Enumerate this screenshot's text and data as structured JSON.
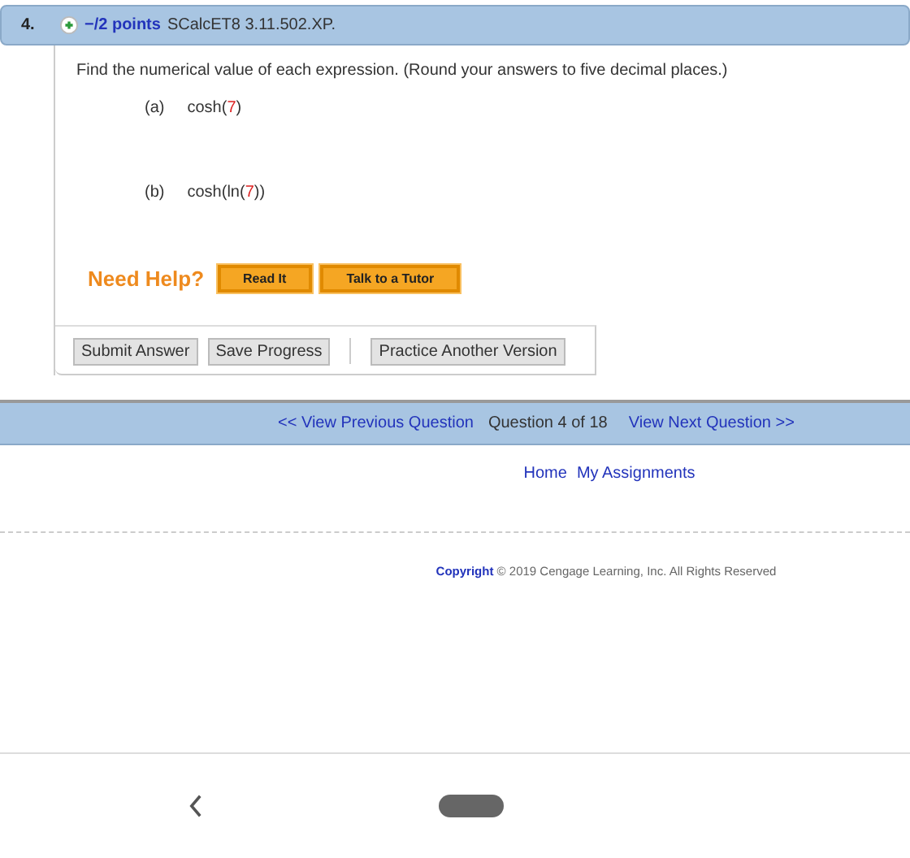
{
  "question": {
    "number": "4.",
    "points": "−/2 points",
    "code": "SCalcET8 3.11.502.XP.",
    "prompt": "Find the numerical value of each expression. (Round your answers to five decimal places.)",
    "parts": [
      {
        "label": "(a)",
        "before": "cosh(",
        "value": "7",
        "after": ")"
      },
      {
        "label": "(b)",
        "before": "cosh(ln(",
        "value": "7",
        "after": "))"
      }
    ],
    "help": {
      "label": "Need Help?",
      "buttons": [
        "Read It",
        "Talk to a Tutor"
      ]
    },
    "actions": [
      "Submit Answer",
      "Save Progress"
    ],
    "practice": "Practice Another Version"
  },
  "nav": {
    "previous": "<< View Previous Question",
    "position": "Question 4 of 18",
    "next": "View Next Question >>"
  },
  "links": [
    "Home",
    "My Assignments"
  ],
  "footer": {
    "link": "Copyright",
    "text": "© 2019 Cengage Learning, Inc. All Rights Reserved"
  }
}
